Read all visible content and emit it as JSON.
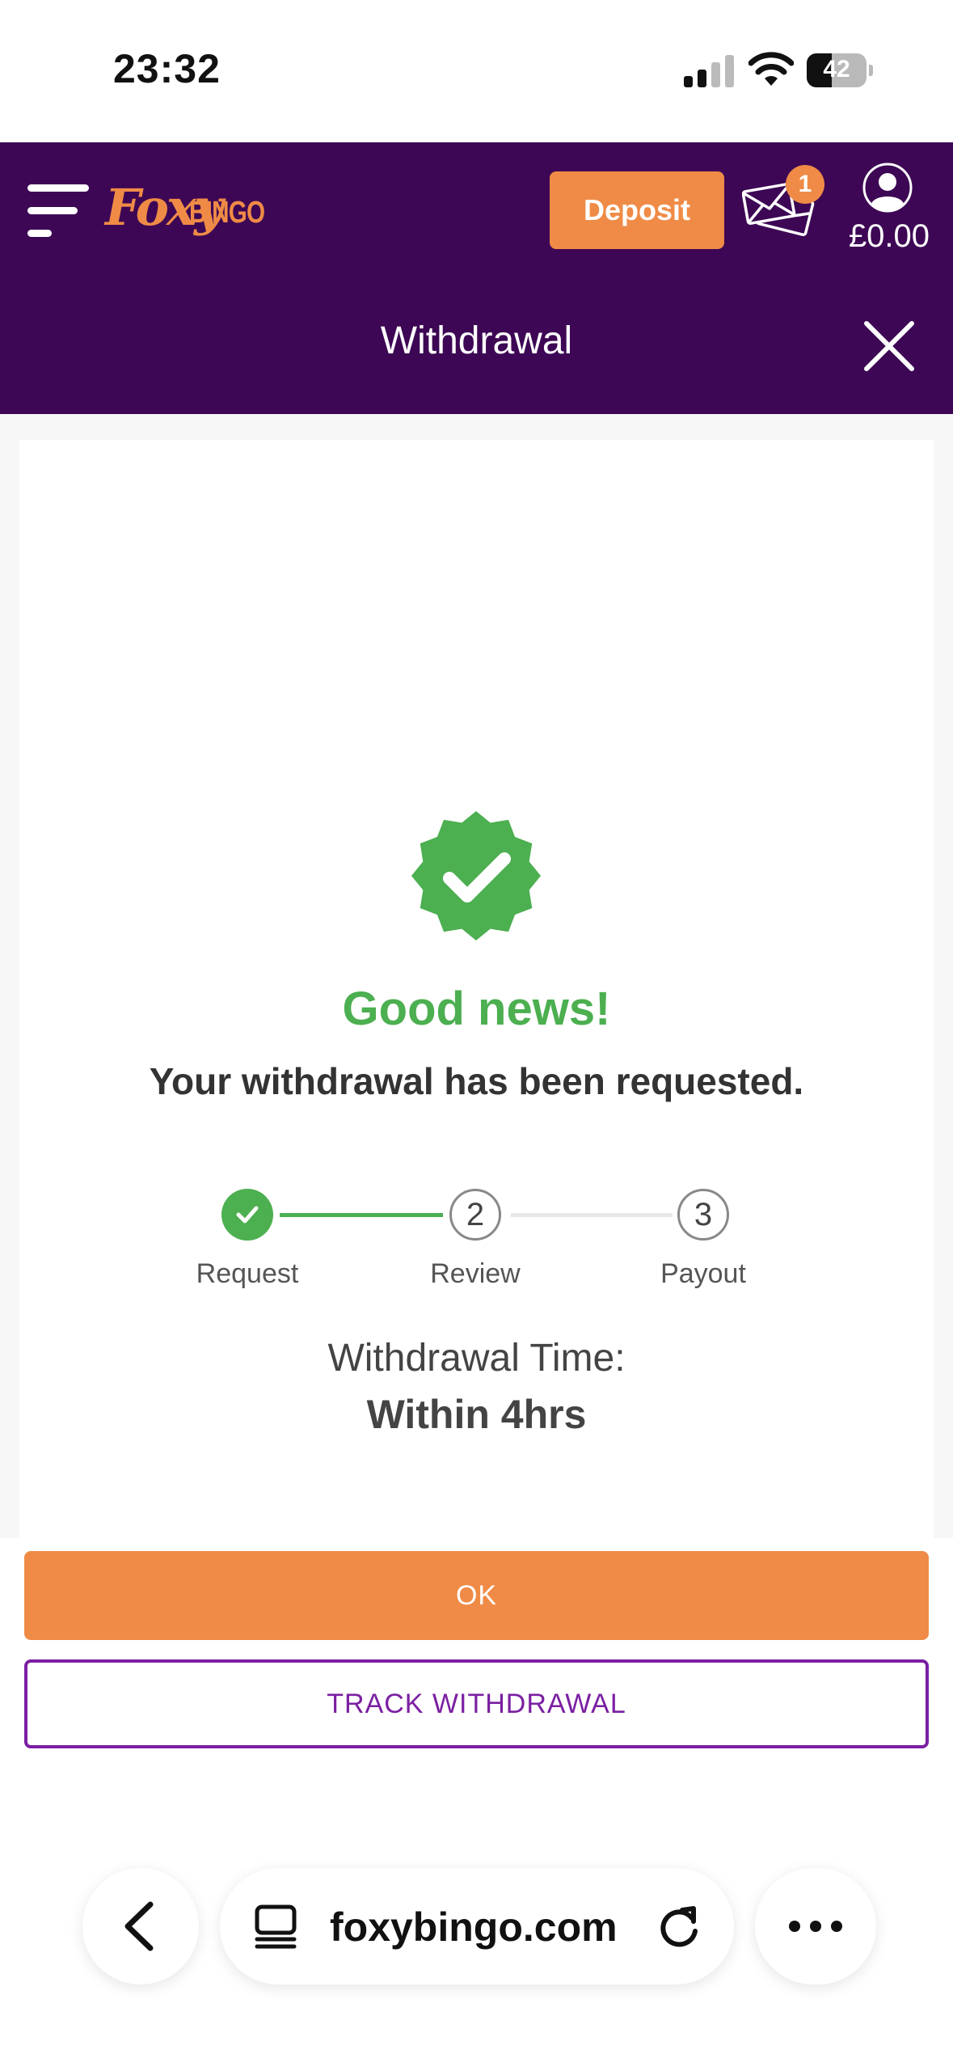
{
  "status_bar": {
    "time": "23:32",
    "battery_level": "42",
    "battery_fraction": 0.42
  },
  "header": {
    "logo_primary": "Foxy",
    "logo_secondary": "BINGO",
    "deposit_label": "Deposit",
    "mail_badge_count": "1",
    "balance": "£0.00",
    "page_title": "Withdrawal"
  },
  "content": {
    "success_icon": "check-badge-icon",
    "headline": "Good news!",
    "message": "Your withdrawal has been requested.",
    "steps": [
      {
        "number": "1",
        "label": "Request",
        "status": "complete"
      },
      {
        "number": "2",
        "label": "Review",
        "status": "pending"
      },
      {
        "number": "3",
        "label": "Payout",
        "status": "pending"
      }
    ],
    "withdrawal_time_label": "Withdrawal Time:",
    "withdrawal_time_value": "Within 4hrs"
  },
  "actions": {
    "ok_label": "OK",
    "track_label": "TRACK WITHDRAWAL"
  },
  "browser": {
    "url": "foxybingo.com"
  },
  "colors": {
    "header_purple": "#3d0755",
    "accent_orange": "#ef8b46",
    "success_green": "#4caf50",
    "track_purple": "#7b1fa2"
  }
}
